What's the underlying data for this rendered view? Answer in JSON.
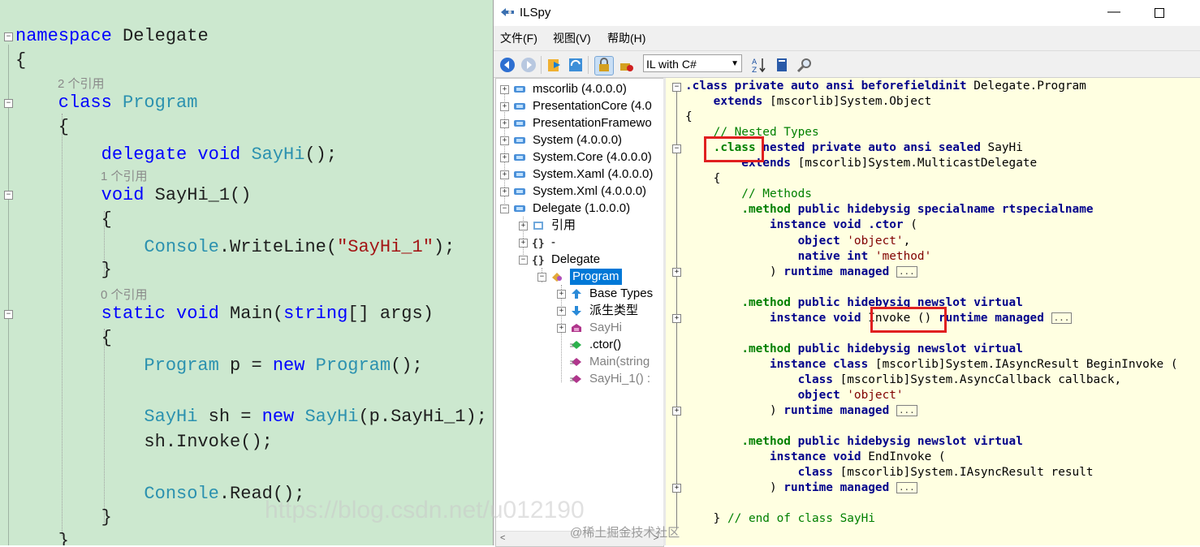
{
  "editor": {
    "lines": [
      [
        {
          "t": "namespace",
          "c": "kw"
        },
        {
          "t": " Delegate",
          "c": "pl"
        }
      ],
      [
        {
          "t": "{",
          "c": "pl"
        }
      ],
      [
        {
          "t": "    class",
          "c": "kw"
        },
        {
          "t": " Program",
          "c": "ty"
        }
      ],
      [
        {
          "t": "    {",
          "c": "pl"
        }
      ],
      [
        {
          "t": "        delegate void",
          "c": "kw"
        },
        {
          "t": " SayHi",
          "c": "ty"
        },
        {
          "t": "();",
          "c": "pl"
        }
      ],
      [
        {
          "t": "        void",
          "c": "kw"
        },
        {
          "t": " SayHi_1()",
          "c": "pl"
        }
      ],
      [
        {
          "t": "        {",
          "c": "pl"
        }
      ],
      [
        {
          "t": "            Console",
          "c": "ty"
        },
        {
          "t": ".WriteLine(",
          "c": "pl"
        },
        {
          "t": "\"SayHi_1\"",
          "c": "st"
        },
        {
          "t": ");",
          "c": "pl"
        }
      ],
      [
        {
          "t": "        }",
          "c": "pl"
        }
      ],
      [
        {
          "t": "        static void",
          "c": "kw"
        },
        {
          "t": " Main(",
          "c": "pl"
        },
        {
          "t": "string",
          "c": "kw"
        },
        {
          "t": "[] args)",
          "c": "pl"
        }
      ],
      [
        {
          "t": "        {",
          "c": "pl"
        }
      ],
      [
        {
          "t": "            Program",
          "c": "ty"
        },
        {
          "t": " p = ",
          "c": "pl"
        },
        {
          "t": "new",
          "c": "kw"
        },
        {
          "t": " Program",
          "c": "ty"
        },
        {
          "t": "();",
          "c": "pl"
        }
      ],
      [
        {
          "t": "            SayHi",
          "c": "ty"
        },
        {
          "t": " sh = ",
          "c": "pl"
        },
        {
          "t": "new",
          "c": "kw"
        },
        {
          "t": " SayHi",
          "c": "ty"
        },
        {
          "t": "(p.SayHi_1);",
          "c": "pl"
        }
      ],
      [
        {
          "t": "            sh.Invoke();",
          "c": "pl"
        }
      ],
      [
        {
          "t": "            Console",
          "c": "ty"
        },
        {
          "t": ".Read();",
          "c": "pl"
        }
      ],
      [
        {
          "t": "        }",
          "c": "pl"
        }
      ],
      [
        {
          "t": "    }",
          "c": "pl"
        }
      ]
    ],
    "refs": [
      "2 个引用",
      "1 个引用",
      "0 个引用"
    ]
  },
  "ilspy": {
    "title": "ILSpy",
    "menu": [
      "文件(F)",
      "视图(V)",
      "帮助(H)"
    ],
    "language": "IL with C#",
    "tree": [
      {
        "label": "mscorlib (4.0.0.0)"
      },
      {
        "label": "PresentationCore (4.0"
      },
      {
        "label": "PresentationFramewo"
      },
      {
        "label": "System (4.0.0.0)"
      },
      {
        "label": "System.Core (4.0.0.0)"
      },
      {
        "label": "System.Xaml (4.0.0.0)"
      },
      {
        "label": "System.Xml (4.0.0.0)"
      },
      {
        "label": "Delegate (1.0.0.0)"
      },
      {
        "label": "引用"
      },
      {
        "label": "-"
      },
      {
        "label": "Delegate"
      },
      {
        "label": "Program"
      },
      {
        "label": "Base Types"
      },
      {
        "label": "派生类型"
      },
      {
        "label": "SayHi"
      },
      {
        "label": ".ctor()"
      },
      {
        "label": "Main(string"
      },
      {
        "label": "SayHi_1() :"
      }
    ],
    "code": [
      [
        {
          "t": ".class private auto ansi beforefieldinit",
          "c": "k"
        },
        {
          "t": " Delegate.Program",
          "c": ""
        }
      ],
      [
        {
          "t": "    extends",
          "c": "k"
        },
        {
          "t": " [mscorlib]System.Object",
          "c": ""
        }
      ],
      [
        {
          "t": "{",
          "c": ""
        }
      ],
      [
        {
          "t": "    // Nested Types",
          "c": "c"
        }
      ],
      [
        {
          "t": "    ",
          "c": ""
        },
        {
          "t": ".class",
          "c": "d"
        },
        {
          "t": " nested private auto ansi sealed",
          "c": "k"
        },
        {
          "t": " SayHi",
          "c": ""
        }
      ],
      [
        {
          "t": "        extends",
          "c": "k"
        },
        {
          "t": " [mscorlib]System.MulticastDelegate",
          "c": ""
        }
      ],
      [
        {
          "t": "    {",
          "c": ""
        }
      ],
      [
        {
          "t": "        // Methods",
          "c": "c"
        }
      ],
      [
        {
          "t": "        ",
          "c": ""
        },
        {
          "t": ".method",
          "c": "d"
        },
        {
          "t": " public hidebysig specialname rtspecialname",
          "c": "k"
        }
      ],
      [
        {
          "t": "            instance void .ctor",
          "c": "k"
        },
        {
          "t": " (",
          "c": ""
        }
      ],
      [
        {
          "t": "                object",
          "c": "k"
        },
        {
          "t": " 'object'",
          "c": "s"
        },
        {
          "t": ",",
          "c": ""
        }
      ],
      [
        {
          "t": "                native int",
          "c": "k"
        },
        {
          "t": " 'method'",
          "c": "s"
        }
      ],
      [
        {
          "t": "            ) ",
          "c": ""
        },
        {
          "t": "runtime managed",
          "c": "k"
        },
        {
          "t": " ",
          "c": ""
        },
        {
          "t": "...",
          "c": "dots"
        }
      ],
      [
        {
          "t": "",
          "c": ""
        }
      ],
      [
        {
          "t": "        ",
          "c": ""
        },
        {
          "t": ".method",
          "c": "d"
        },
        {
          "t": " public hidebysig newslot virtual",
          "c": "k"
        }
      ],
      [
        {
          "t": "            instance void",
          "c": "k"
        },
        {
          "t": " Invoke () ",
          "c": ""
        },
        {
          "t": "runtime managed",
          "c": "k"
        },
        {
          "t": " ",
          "c": ""
        },
        {
          "t": "...",
          "c": "dots"
        }
      ],
      [
        {
          "t": "",
          "c": ""
        }
      ],
      [
        {
          "t": "        ",
          "c": ""
        },
        {
          "t": ".method",
          "c": "d"
        },
        {
          "t": " public hidebysig newslot virtual",
          "c": "k"
        }
      ],
      [
        {
          "t": "            instance class",
          "c": "k"
        },
        {
          "t": " [mscorlib]System.IAsyncResult BeginInvoke (",
          "c": ""
        }
      ],
      [
        {
          "t": "                class",
          "c": "k"
        },
        {
          "t": " [mscorlib]System.AsyncCallback callback,",
          "c": ""
        }
      ],
      [
        {
          "t": "                object",
          "c": "k"
        },
        {
          "t": " 'object'",
          "c": "s"
        }
      ],
      [
        {
          "t": "            ) ",
          "c": ""
        },
        {
          "t": "runtime managed",
          "c": "k"
        },
        {
          "t": " ",
          "c": ""
        },
        {
          "t": "...",
          "c": "dots"
        }
      ],
      [
        {
          "t": "",
          "c": ""
        }
      ],
      [
        {
          "t": "        ",
          "c": ""
        },
        {
          "t": ".method",
          "c": "d"
        },
        {
          "t": " public hidebysig newslot virtual",
          "c": "k"
        }
      ],
      [
        {
          "t": "            instance void",
          "c": "k"
        },
        {
          "t": " EndInvoke (",
          "c": ""
        }
      ],
      [
        {
          "t": "                class",
          "c": "k"
        },
        {
          "t": " [mscorlib]System.IAsyncResult result",
          "c": ""
        }
      ],
      [
        {
          "t": "            ) ",
          "c": ""
        },
        {
          "t": "runtime managed",
          "c": "k"
        },
        {
          "t": " ",
          "c": ""
        },
        {
          "t": "...",
          "c": "dots"
        }
      ],
      [
        {
          "t": "",
          "c": ""
        }
      ],
      [
        {
          "t": "    } ",
          "c": ""
        },
        {
          "t": "// end of class SayHi",
          "c": "c"
        }
      ]
    ]
  },
  "watermark": "https://blog.csdn.net/u012190",
  "watermark2": "@稀土掘金技术社区",
  "colors": {
    "editor_bg": "#cce8cf",
    "code_bg": "#ffffe1",
    "selection": "#0078d7",
    "highlight_box": "#e02020"
  }
}
